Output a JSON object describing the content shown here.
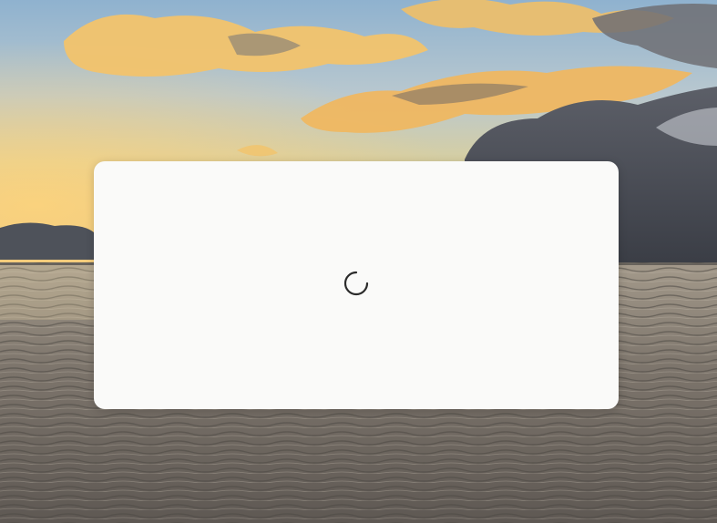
{
  "desktop": {
    "wallpaper_icon": "sunset-sea-wallpaper"
  },
  "dialog": {
    "state": "loading",
    "spinner_icon": "loading-spinner-icon",
    "spinner_color": "#2b2b2b",
    "background_color": "#fafaf9"
  }
}
